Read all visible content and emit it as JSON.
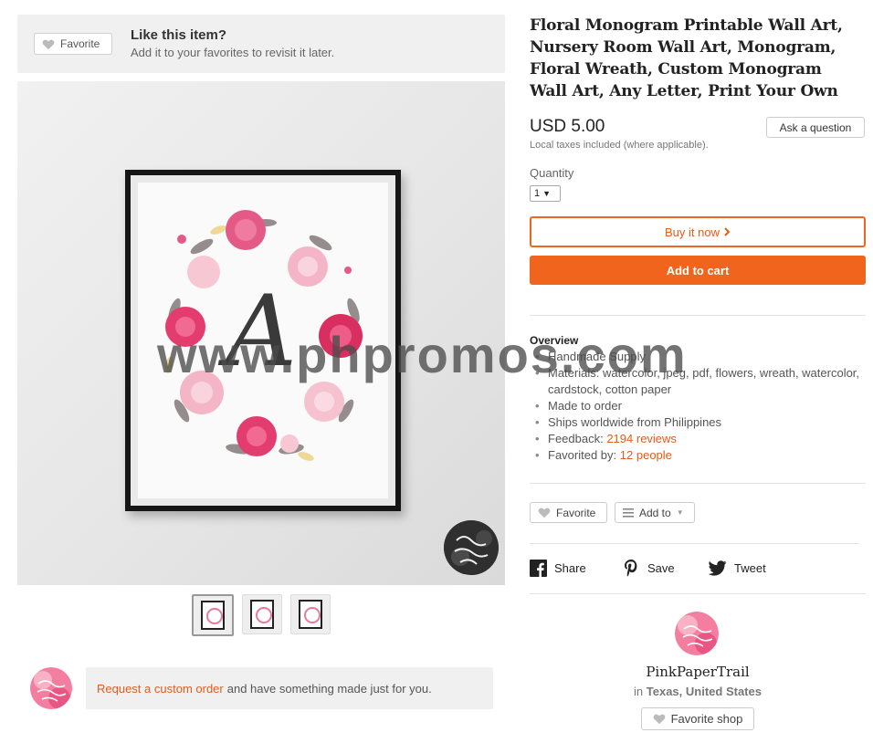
{
  "favorite_prompt": {
    "button_label": "Favorite",
    "title": "Like this item?",
    "subtitle": "Add it to your favorites to revisit it later."
  },
  "product": {
    "title": "Floral Monogram Printable Wall Art, Nursery Room Wall Art, Monogram, Floral Wreath, Custom Monogram Wall Art, Any Letter, Print Your Own",
    "price": "USD 5.00",
    "tax_note": "Local taxes included (where applicable).",
    "ask_button": "Ask a question",
    "quantity_label": "Quantity",
    "quantity_value": "1",
    "buy_now_label": "Buy it now",
    "add_to_cart_label": "Add to cart",
    "image_letter": "A"
  },
  "overview": {
    "title": "Overview",
    "items": [
      "Handmade Supply",
      "Materials: watercolor, jpeg, pdf, flowers, wreath, watercolor, cardstock, cotton paper",
      "Made to order",
      "Ships worldwide from Philippines"
    ],
    "feedback_label": "Feedback:",
    "feedback_link": "2194 reviews",
    "favorited_label": "Favorited by:",
    "favorited_link": "12 people"
  },
  "actions": {
    "favorite_label": "Favorite",
    "add_to_label": "Add to"
  },
  "share": {
    "facebook": "Share",
    "pinterest": "Save",
    "twitter": "Tweet"
  },
  "shop": {
    "name": "PinkPaperTrail",
    "location_prefix": "in",
    "location": "Texas, United States",
    "favorite_shop_label": "Favorite shop",
    "logo_text": "Pink Paper Trail"
  },
  "custom_order": {
    "link": "Request a custom order",
    "text": "and have something made just for you."
  },
  "watermark": "www.phpromos.com",
  "colors": {
    "accent_orange": "#f1641e",
    "link_orange": "#e45c1a",
    "panel_gray": "#f0f0f0"
  },
  "icons": {
    "heart": "heart-icon",
    "chevron": "chevron-right-icon",
    "menu": "list-icon",
    "facebook": "facebook-icon",
    "pinterest": "pinterest-icon",
    "twitter": "twitter-icon"
  }
}
